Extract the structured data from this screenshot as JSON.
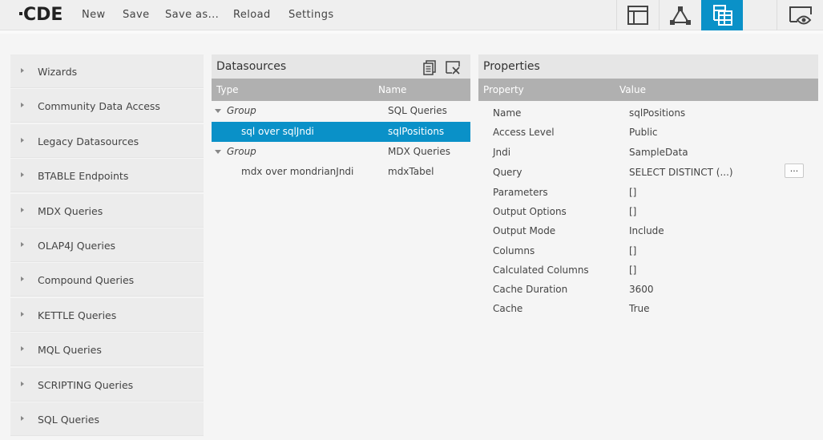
{
  "app": {
    "logo_text": "CDE"
  },
  "menu": {
    "new": "New",
    "save": "Save",
    "save_as": "Save as...",
    "reload": "Reload",
    "settings": "Settings"
  },
  "view_buttons": [
    {
      "icon": "layout-icon",
      "active": false
    },
    {
      "icon": "components-icon",
      "active": false
    },
    {
      "icon": "datasources-icon",
      "active": true
    },
    {
      "icon": "preview-icon",
      "active": false
    }
  ],
  "colors": {
    "accent": "#0a91c8",
    "header_gray": "#b0b0b0"
  },
  "sidebar": {
    "items": [
      {
        "label": "Wizards"
      },
      {
        "label": "Community Data Access"
      },
      {
        "label": "Legacy Datasources"
      },
      {
        "label": "BTABLE Endpoints"
      },
      {
        "label": "MDX Queries"
      },
      {
        "label": "OLAP4J Queries"
      },
      {
        "label": "Compound Queries"
      },
      {
        "label": "KETTLE Queries"
      },
      {
        "label": "MQL Queries"
      },
      {
        "label": "SCRIPTING Queries"
      },
      {
        "label": "SQL Queries"
      }
    ]
  },
  "datasources": {
    "title": "Datasources",
    "columns": {
      "type": "Type",
      "name": "Name"
    },
    "rows": [
      {
        "type": "Group",
        "name": "SQL Queries",
        "is_group": true,
        "selected": false
      },
      {
        "type": "sql over sqlJndi",
        "name": "sqlPositions",
        "is_group": false,
        "selected": true
      },
      {
        "type": "Group",
        "name": "MDX Queries",
        "is_group": true,
        "selected": false
      },
      {
        "type": "mdx over mondrianJndi",
        "name": "mdxTabel",
        "is_group": false,
        "selected": false
      }
    ]
  },
  "properties": {
    "title": "Properties",
    "columns": {
      "property": "Property",
      "value": "Value"
    },
    "more_label": "...",
    "rows": [
      {
        "name": "Name",
        "value": "sqlPositions"
      },
      {
        "name": "Access Level",
        "value": "Public"
      },
      {
        "name": "Jndi",
        "value": "SampleData"
      },
      {
        "name": "Query",
        "value": "SELECT DISTINCT (...)"
      },
      {
        "name": "Parameters",
        "value": "[]"
      },
      {
        "name": "Output Options",
        "value": "[]"
      },
      {
        "name": "Output Mode",
        "value": "Include"
      },
      {
        "name": "Columns",
        "value": "[]"
      },
      {
        "name": "Calculated Columns",
        "value": "[]"
      },
      {
        "name": "Cache Duration",
        "value": "3600"
      },
      {
        "name": "Cache",
        "value": "True"
      }
    ]
  }
}
